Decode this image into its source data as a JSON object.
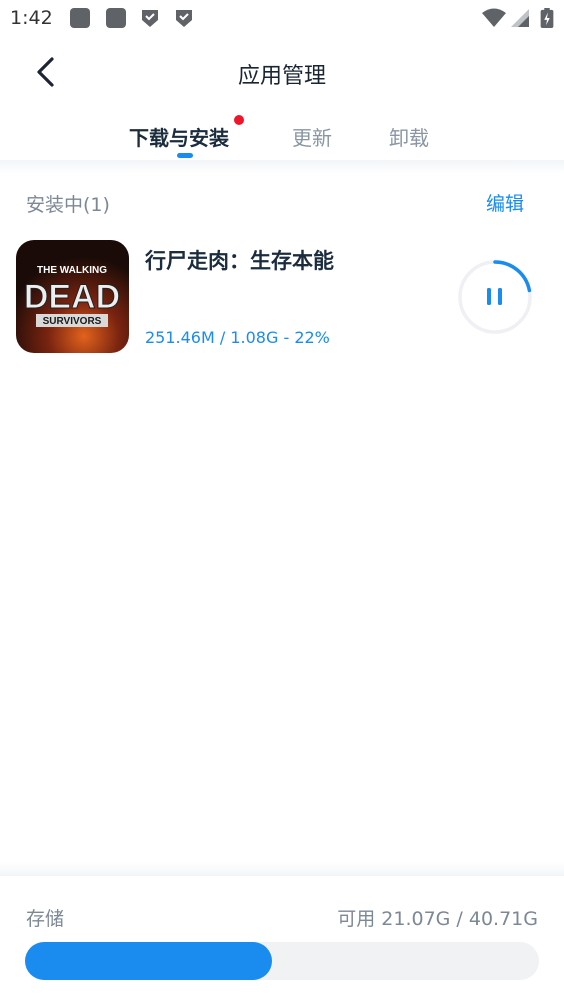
{
  "status_bar": {
    "time": "1:42"
  },
  "header": {
    "title": "应用管理",
    "back_icon": "chevron-left-icon"
  },
  "tabs": [
    {
      "label": "下载与安装",
      "active": true,
      "has_badge": true
    },
    {
      "label": "更新",
      "active": false
    },
    {
      "label": "卸载",
      "active": false
    }
  ],
  "section": {
    "title": "安装中(1)",
    "edit_label": "编辑"
  },
  "apps": [
    {
      "name": "行尸走肉：生存本能",
      "icon_text_top": "THE WALKING",
      "icon_text_main": "DEAD",
      "icon_text_bottom": "SURVIVORS",
      "progress_text": "251.46M / 1.08G - 22%",
      "progress_fraction": 0.22,
      "action_icon": "pause-icon"
    }
  ],
  "storage": {
    "label": "存储",
    "value": "可用 21.07G / 40.71G",
    "used_fraction": 0.48
  },
  "colors": {
    "accent": "#1a8cf0",
    "badge": "#f0152a",
    "title": "#1b2c3f",
    "secondary": "#7d8896"
  }
}
